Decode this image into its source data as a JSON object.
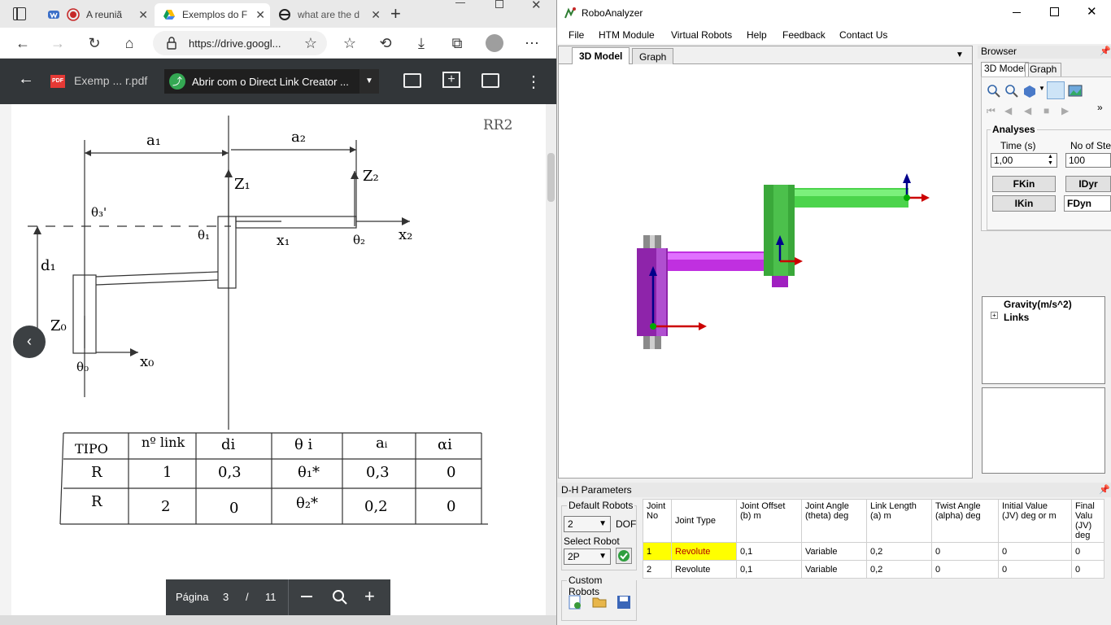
{
  "browser": {
    "tabs": [
      {
        "label": "A reuniã",
        "icon": "recording-icon"
      },
      {
        "label": "Exemplos do F",
        "icon": "google-drive-icon"
      },
      {
        "label": "what are the d",
        "icon": "edge-icon"
      }
    ],
    "new_tab": "+",
    "url": "https://drive.googl...",
    "pdf_toolbar": {
      "filename": "Exemp ... r.pdf",
      "pdf_badge": "PDF",
      "open_with": "Abrir com o Direct Link Creator ..."
    },
    "page_controls": {
      "label": "Página",
      "current": "3",
      "separator": "/",
      "total": "11"
    }
  },
  "drawing": {
    "corner_label": "RR2",
    "a1": "a₁",
    "a2": "a₂",
    "z1": "Z₁",
    "z2": "Z₂",
    "z0": "Z₀",
    "theta3": "θ₃'",
    "theta1": "θ₁",
    "theta2": "θ₂",
    "theta0": "θ₀",
    "x1": "x₁",
    "x2": "x₂",
    "x0": "x₀",
    "d1": "d₁",
    "table": {
      "headers": [
        "TIPO",
        "nº link",
        "di",
        "θ i",
        "aᵢ",
        "αi"
      ],
      "rows": [
        [
          "R",
          "1",
          "0,3",
          "θ₁*",
          "0,3",
          "0"
        ],
        [
          "R",
          "2",
          "0",
          "θ₂*",
          "0,2",
          "0"
        ]
      ]
    }
  },
  "robo": {
    "title": "RoboAnalyzer",
    "menu": [
      "File",
      "HTM Module",
      "Virtual Robots",
      "Help",
      "Feedback",
      "Contact Us"
    ],
    "view_tabs": [
      "3D Model",
      "Graph"
    ],
    "browser_panel": {
      "title": "Browser",
      "tabs": [
        "3D Model",
        "Graph"
      ],
      "analyses": {
        "title": "Analyses",
        "time_label": "Time (s)",
        "time_value": "1,00",
        "steps_label": "No of Ste",
        "steps_value": "100",
        "buttons": [
          "FKin",
          "IDyr",
          "IKin",
          "FDyn"
        ]
      },
      "tree": [
        "Gravity(m/s^2)",
        "Links"
      ]
    },
    "dh": {
      "title": "D-H Parameters",
      "default_robots_label": "Default Robots",
      "dof_value": "2",
      "dof_label": "DOF",
      "select_robot_label": "Select Robot",
      "select_robot_value": "2P",
      "custom_robots_label": "Custom Robots",
      "columns": [
        [
          "Joint",
          "No"
        ],
        [
          "Joint Type",
          ""
        ],
        [
          "Joint Offset",
          "(b)  m"
        ],
        [
          "Joint Angle",
          "(theta)  deg"
        ],
        [
          "Link Length",
          "(a)  m"
        ],
        [
          "Twist Angle",
          "(alpha)  deg"
        ],
        [
          "Initial Value",
          "(JV)   deg or m"
        ],
        [
          "Final Valu",
          "(JV)   deg"
        ]
      ],
      "rows": [
        [
          "1",
          "Revolute",
          "0,1",
          "Variable",
          "0,2",
          "0",
          "0",
          "0"
        ],
        [
          "2",
          "Revolute",
          "0,1",
          "Variable",
          "0,2",
          "0",
          "0",
          "0"
        ]
      ]
    }
  }
}
